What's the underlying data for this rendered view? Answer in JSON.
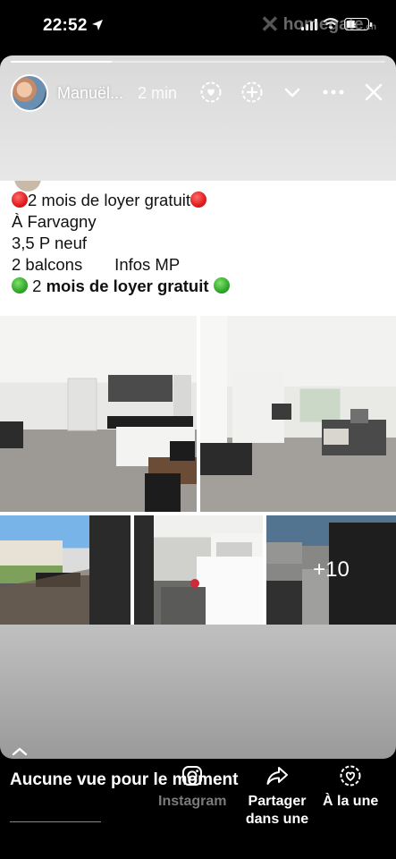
{
  "status": {
    "time": "22:52",
    "battery": "5"
  },
  "watermark": {
    "brand": "homegate",
    "tld": ".ch"
  },
  "story": {
    "author": "Manuël...",
    "time_ago": "2 min",
    "progress": 0.27
  },
  "post": {
    "lines": {
      "l1_text": "2 mois de loyer gratuit",
      "l2": "À Farvagny",
      "l3": "3,5 P neuf",
      "l4": "2 balcons       Infos MP",
      "l5_a": "2 ",
      "l5_b": "mois de loyer gratuit"
    },
    "more_photos": "+10"
  },
  "bottom": {
    "no_views": "Aucune vue pour le moment",
    "actions": {
      "instagram": "Instagram",
      "share": "Partager dans une",
      "mention": "À la une"
    }
  },
  "icons": [
    "location-arrow-icon",
    "signal-icon",
    "wifi-icon",
    "battery-icon",
    "story-circle-icon",
    "add-circle-icon",
    "chevron-down-icon",
    "more-icon",
    "close-icon",
    "instagram-icon",
    "share-icon",
    "highlight-heart-icon",
    "swipe-up-chevron-icon"
  ]
}
